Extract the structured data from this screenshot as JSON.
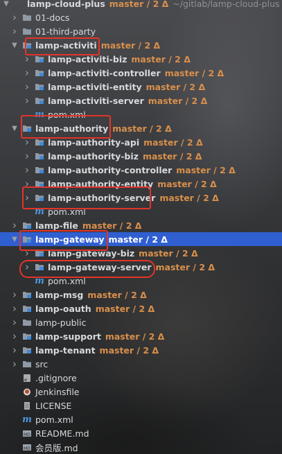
{
  "project_tree": {
    "root": {
      "name": "lamp-cloud-plus",
      "branch": "master / 2 Δ",
      "path": "~/gitlab/lamp-cloud-plus"
    },
    "items": [
      {
        "id": "docs",
        "name": "01-docs",
        "branch": "",
        "kind": "folder",
        "expander": "collapsed",
        "bold": false
      },
      {
        "id": "third_party",
        "name": "01-third-party",
        "branch": "",
        "kind": "folder",
        "expander": "collapsed",
        "bold": false
      },
      {
        "id": "activiti",
        "name": "lamp-activiti",
        "branch": "master / 2 Δ",
        "kind": "module",
        "expander": "expanded",
        "bold": true
      },
      {
        "id": "activiti_biz",
        "name": "lamp-activiti-biz",
        "branch": "master / 2 Δ",
        "kind": "module",
        "expander": "collapsed",
        "bold": true
      },
      {
        "id": "activiti_controller",
        "name": "lamp-activiti-controller",
        "branch": "master / 2 Δ",
        "kind": "module",
        "expander": "collapsed",
        "bold": true
      },
      {
        "id": "activiti_entity",
        "name": "lamp-activiti-entity",
        "branch": "master / 2 Δ",
        "kind": "module",
        "expander": "collapsed",
        "bold": true
      },
      {
        "id": "activiti_server",
        "name": "lamp-activiti-server",
        "branch": "master / 2 Δ",
        "kind": "module",
        "expander": "collapsed",
        "bold": true
      },
      {
        "id": "activiti_pom",
        "name": "pom.xml",
        "branch": "",
        "kind": "maven",
        "expander": "none",
        "bold": false
      },
      {
        "id": "authority",
        "name": "lamp-authority",
        "branch": "master / 2 Δ",
        "kind": "module",
        "expander": "expanded",
        "bold": true
      },
      {
        "id": "authority_api",
        "name": "lamp-authority-api",
        "branch": "master / 2 Δ",
        "kind": "module",
        "expander": "collapsed",
        "bold": true
      },
      {
        "id": "authority_biz",
        "name": "lamp-authority-biz",
        "branch": "master / 2 Δ",
        "kind": "module",
        "expander": "collapsed",
        "bold": true
      },
      {
        "id": "authority_controller",
        "name": "lamp-authority-controller",
        "branch": "master / 2 Δ",
        "kind": "module",
        "expander": "collapsed",
        "bold": true
      },
      {
        "id": "authority_entity",
        "name": "lamp-authority-entity",
        "branch": "master / 2 Δ",
        "kind": "module",
        "expander": "collapsed",
        "bold": true
      },
      {
        "id": "authority_server",
        "name": "lamp-authority-server",
        "branch": "master / 2 Δ",
        "kind": "module",
        "expander": "collapsed",
        "bold": true
      },
      {
        "id": "authority_pom",
        "name": "pom.xml",
        "branch": "",
        "kind": "maven",
        "expander": "none",
        "bold": false
      },
      {
        "id": "file",
        "name": "lamp-file",
        "branch": "master / 2 Δ",
        "kind": "module",
        "expander": "collapsed",
        "bold": true
      },
      {
        "id": "gateway",
        "name": "lamp-gateway",
        "branch": "master / 2 Δ",
        "kind": "module",
        "expander": "expanded",
        "bold": true
      },
      {
        "id": "gateway_biz",
        "name": "lamp-gateway-biz",
        "branch": "master / 2 Δ",
        "kind": "module",
        "expander": "collapsed",
        "bold": true
      },
      {
        "id": "gateway_server",
        "name": "lamp-gateway-server",
        "branch": "master / 2 Δ",
        "kind": "module",
        "expander": "collapsed",
        "bold": true
      },
      {
        "id": "gateway_pom",
        "name": "pom.xml",
        "branch": "",
        "kind": "maven",
        "expander": "none",
        "bold": false
      },
      {
        "id": "msg",
        "name": "lamp-msg",
        "branch": "master / 2 Δ",
        "kind": "module",
        "expander": "collapsed",
        "bold": true
      },
      {
        "id": "oauth",
        "name": "lamp-oauth",
        "branch": "master / 2 Δ",
        "kind": "module",
        "expander": "collapsed",
        "bold": true
      },
      {
        "id": "public",
        "name": "lamp-public",
        "branch": "",
        "kind": "folder",
        "expander": "collapsed",
        "bold": false
      },
      {
        "id": "support",
        "name": "lamp-support",
        "branch": "master / 2 Δ",
        "kind": "module",
        "expander": "collapsed",
        "bold": true
      },
      {
        "id": "tenant",
        "name": "lamp-tenant",
        "branch": "master / 2 Δ",
        "kind": "module",
        "expander": "collapsed",
        "bold": true
      },
      {
        "id": "src",
        "name": "src",
        "branch": "",
        "kind": "folder",
        "expander": "collapsed",
        "bold": false
      },
      {
        "id": "gitignore",
        "name": ".gitignore",
        "branch": "",
        "kind": "gitignore",
        "expander": "none",
        "bold": false
      },
      {
        "id": "jenkinsfile",
        "name": "Jenkinsfile",
        "branch": "",
        "kind": "jenkins",
        "expander": "none",
        "bold": false
      },
      {
        "id": "license",
        "name": "LICENSE",
        "branch": "",
        "kind": "text",
        "expander": "none",
        "bold": false
      },
      {
        "id": "root_pom",
        "name": "pom.xml",
        "branch": "",
        "kind": "maven",
        "expander": "none",
        "bold": false
      },
      {
        "id": "readme",
        "name": "README.md",
        "branch": "",
        "kind": "markdown",
        "expander": "none",
        "bold": false
      },
      {
        "id": "member_md",
        "name": "会员版.md",
        "branch": "",
        "kind": "markdown",
        "expander": "none",
        "bold": false
      }
    ]
  },
  "selected_item": "gateway",
  "colors": {
    "branch": "#d9904c",
    "selection": "#2f5fd0",
    "highlight": "#e3342a",
    "folder": "#8f9aa6",
    "module_badge": "#3f8ad8"
  }
}
